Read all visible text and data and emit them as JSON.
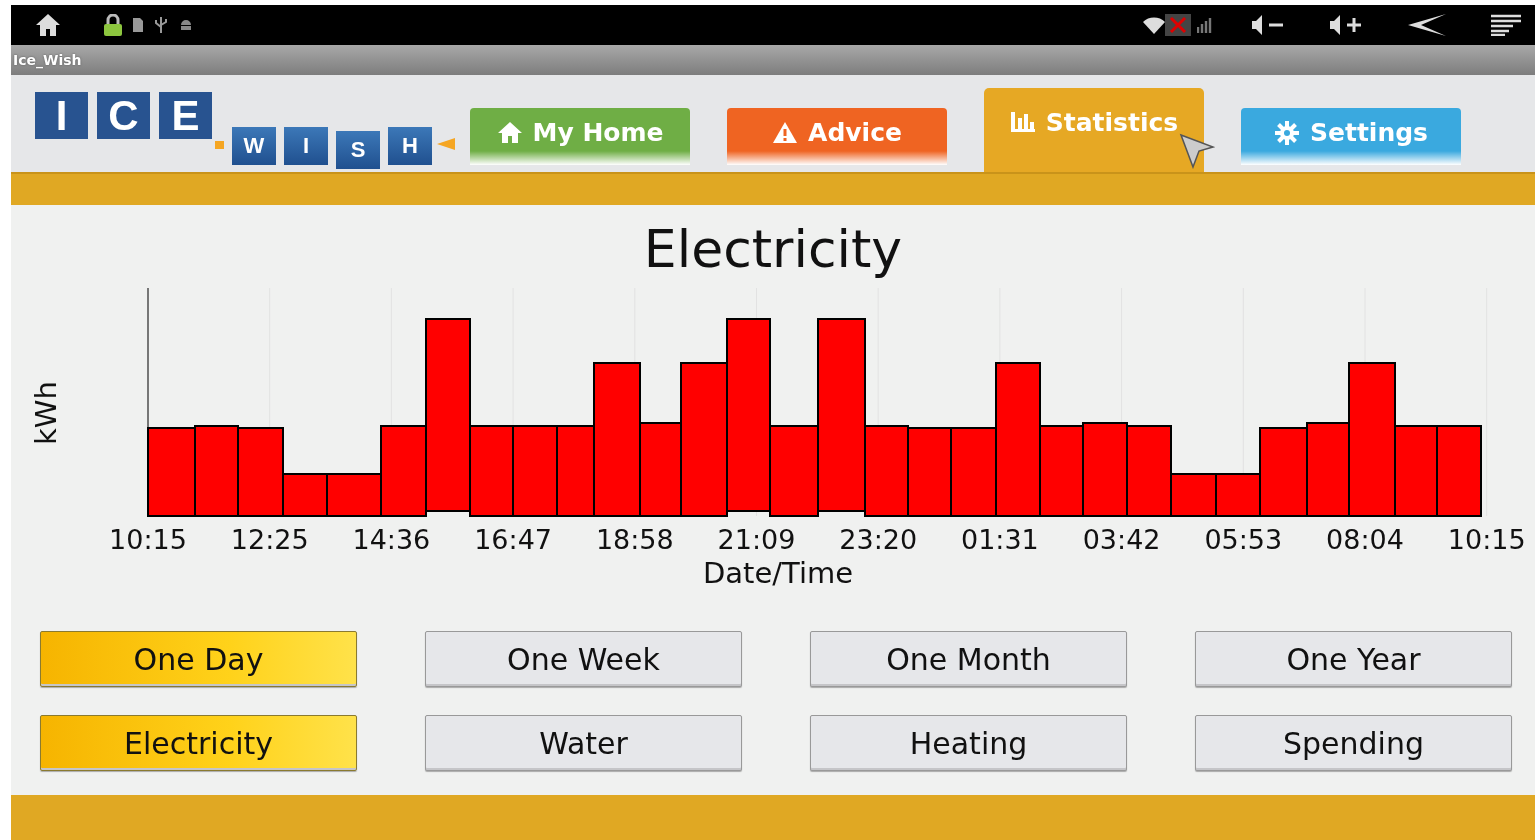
{
  "window": {
    "title": "Ice_Wish"
  },
  "logo": {
    "letters_top": [
      "I",
      "C",
      "E"
    ],
    "letters_bottom": [
      "W",
      "I",
      "S",
      "H"
    ]
  },
  "tabs": [
    {
      "label": "My Home",
      "kind": "home",
      "color": "#6fae45",
      "selected": false
    },
    {
      "label": "Advice",
      "kind": "warning",
      "color": "#ef6422",
      "selected": false
    },
    {
      "label": "Statistics",
      "kind": "chart",
      "color": "#e6a824",
      "selected": true
    },
    {
      "label": "Settings",
      "kind": "gear",
      "color": "#3aa9df",
      "selected": false
    }
  ],
  "chart": {
    "title": "Electricity",
    "ylabel": "kWh",
    "xlabel": "Date/Time",
    "x_labels": [
      "10:15",
      "12:25",
      "14:36",
      "16:47",
      "18:58",
      "21:09",
      "23:20",
      "01:31",
      "03:42",
      "05:53",
      "08:04",
      "10:15"
    ]
  },
  "period_buttons": [
    {
      "label": "One Day",
      "selected": true
    },
    {
      "label": "One Week",
      "selected": false
    },
    {
      "label": "One Month",
      "selected": false
    },
    {
      "label": "One Year",
      "selected": false
    }
  ],
  "metric_buttons": [
    {
      "label": "Electricity",
      "selected": true
    },
    {
      "label": "Water",
      "selected": false
    },
    {
      "label": "Heating",
      "selected": false
    },
    {
      "label": "Spending",
      "selected": false
    }
  ]
}
